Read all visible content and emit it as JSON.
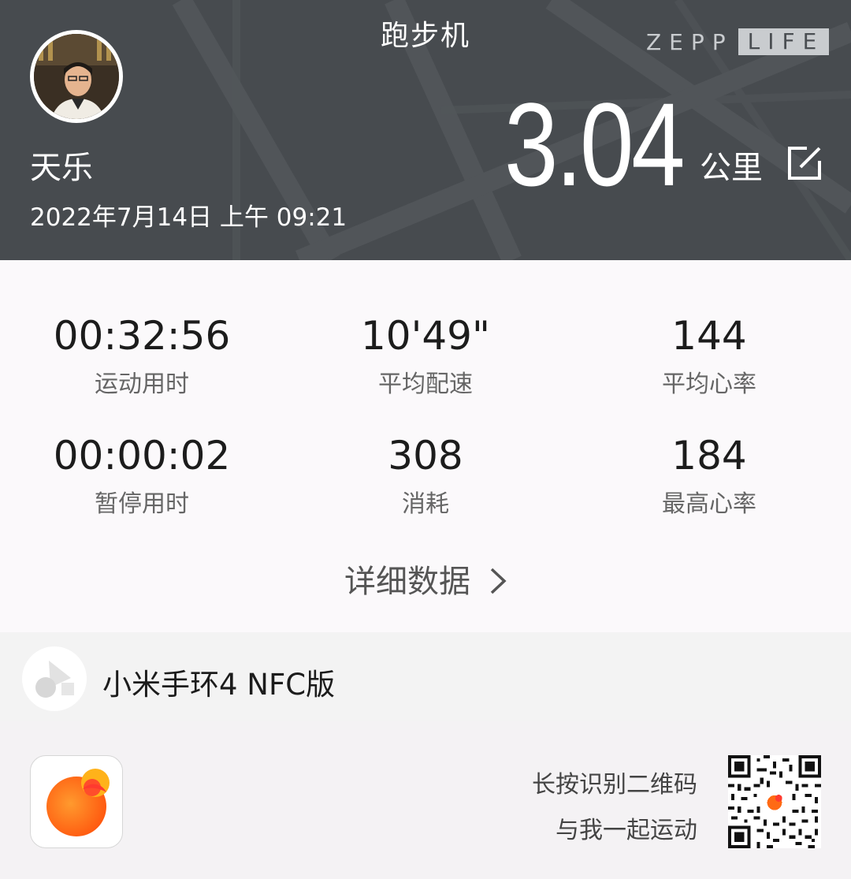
{
  "header": {
    "title": "跑步机",
    "brand_left": "ZEPP",
    "brand_right": "LIFE",
    "user_name": "天乐",
    "date": "2022年7月14日 上午 09:21",
    "distance": "3.04",
    "distance_unit": "公里",
    "edit_icon": "edit-icon"
  },
  "stats": [
    {
      "value": "00:32:56",
      "label": "运动用时"
    },
    {
      "value": "10'49\"",
      "label": "平均配速"
    },
    {
      "value": "144",
      "label": "平均心率"
    },
    {
      "value": "00:00:02",
      "label": "暂停用时"
    },
    {
      "value": "308",
      "label": "消耗"
    },
    {
      "value": "184",
      "label": "最高心率"
    }
  ],
  "detail_link": "详细数据",
  "device": {
    "name": "小米手环4 NFC版"
  },
  "footer": {
    "qr_line1": "长按识别二维码",
    "qr_line2": "与我一起运动"
  },
  "colors": {
    "header_bg": "#4a4e52",
    "accent_orange": "#ff7a1a",
    "accent_red": "#ff3b2f"
  }
}
